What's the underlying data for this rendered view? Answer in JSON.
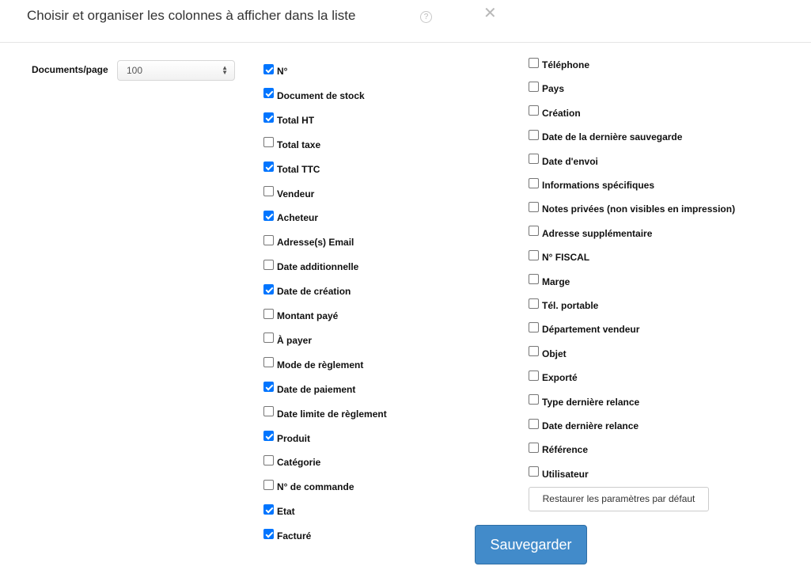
{
  "dialog": {
    "title": "Choisir et organiser les colonnes à afficher dans la liste",
    "help_icon": "question-circle-icon",
    "help_glyph": "?",
    "close_icon": "close-icon",
    "close_glyph": "✕"
  },
  "per_page": {
    "label": "Documents/page",
    "value": "100"
  },
  "columns_left": [
    {
      "label": "N°",
      "checked": true
    },
    {
      "label": "Document de stock",
      "checked": true
    },
    {
      "label": "Total HT",
      "checked": true
    },
    {
      "label": "Total taxe",
      "checked": false
    },
    {
      "label": "Total TTC",
      "checked": true
    },
    {
      "label": "Vendeur",
      "checked": false
    },
    {
      "label": "Acheteur",
      "checked": true
    },
    {
      "label": "Adresse(s) Email",
      "checked": false
    },
    {
      "label": "Date additionnelle",
      "checked": false
    },
    {
      "label": "Date de création",
      "checked": true
    },
    {
      "label": "Montant payé",
      "checked": false
    },
    {
      "label": "À payer",
      "checked": false
    },
    {
      "label": "Mode de règlement",
      "checked": false
    },
    {
      "label": "Date de paiement",
      "checked": true
    },
    {
      "label": "Date limite de règlement",
      "checked": false
    },
    {
      "label": "Produit",
      "checked": true
    },
    {
      "label": "Catégorie",
      "checked": false
    },
    {
      "label": "N° de commande",
      "checked": false
    },
    {
      "label": "Etat",
      "checked": true
    },
    {
      "label": "Facturé",
      "checked": true
    }
  ],
  "columns_right": [
    {
      "label": "Téléphone",
      "checked": false
    },
    {
      "label": "Pays",
      "checked": false
    },
    {
      "label": "Création",
      "checked": false
    },
    {
      "label": "Date de la dernière sauvegarde",
      "checked": false
    },
    {
      "label": "Date d'envoi",
      "checked": false
    },
    {
      "label": "Informations spécifiques",
      "checked": false
    },
    {
      "label": "Notes privées (non visibles en impression)",
      "checked": false
    },
    {
      "label": "Adresse supplémentaire",
      "checked": false
    },
    {
      "label": "N° FISCAL",
      "checked": false
    },
    {
      "label": "Marge",
      "checked": false
    },
    {
      "label": "Tél. portable",
      "checked": false
    },
    {
      "label": "Département vendeur",
      "checked": false
    },
    {
      "label": "Objet",
      "checked": false
    },
    {
      "label": "Exporté",
      "checked": false
    },
    {
      "label": "Type dernière relance",
      "checked": false
    },
    {
      "label": "Date dernière relance",
      "checked": false
    },
    {
      "label": "Référence",
      "checked": false
    },
    {
      "label": "Utilisateur",
      "checked": false
    }
  ],
  "buttons": {
    "restore_label": "Restaurer les paramètres par défaut",
    "save_label": "Sauvegarder"
  },
  "colors": {
    "checkbox_checked": "#0075ff",
    "save_button": "#428bca"
  }
}
